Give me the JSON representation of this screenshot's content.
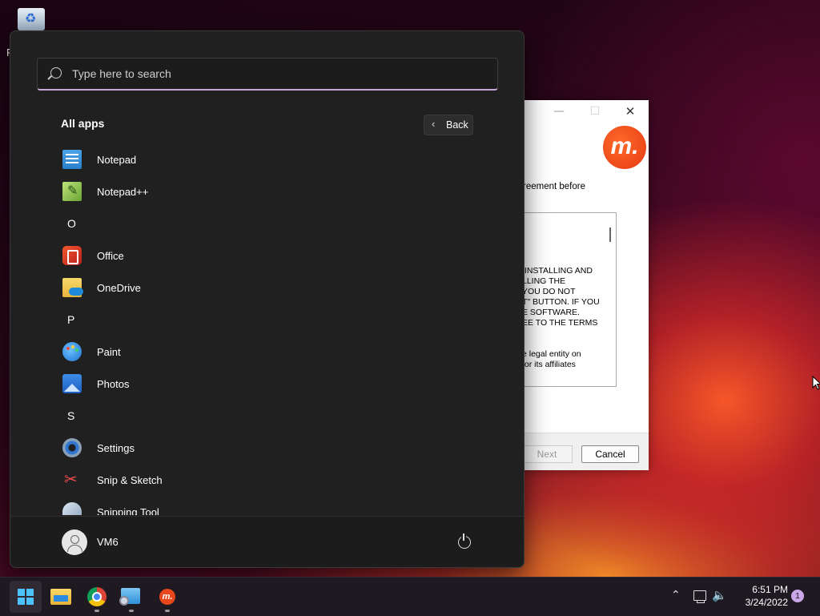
{
  "desktop": {
    "recycle_bin_label": "R"
  },
  "installer": {
    "minimize_glyph": "—",
    "maximize_glyph": "☐",
    "close_glyph": "✕",
    "logo_text": "m.",
    "header_text": "reement before",
    "license_text": " INSTALLING AND\nLLING THE\nYOU DO NOT\nT\" BUTTON. IF YOU\nE SOFTWARE.\nEE TO THE TERMS",
    "license_text_2": "e legal entity on\nfor its affiliates",
    "next_label": "Next",
    "cancel_label": "Cancel"
  },
  "start_menu": {
    "search_placeholder": "Type here to search",
    "all_apps_label": "All apps",
    "back_label": "Back",
    "apps": [
      {
        "type": "app",
        "name": "Notepad",
        "icon": "notepad-icon"
      },
      {
        "type": "app",
        "name": "Notepad++",
        "icon": "notepad-plus-plus-icon"
      },
      {
        "type": "letter",
        "name": "O"
      },
      {
        "type": "app",
        "name": "Office",
        "icon": "office-icon"
      },
      {
        "type": "app",
        "name": "OneDrive",
        "icon": "onedrive-icon"
      },
      {
        "type": "letter",
        "name": "P"
      },
      {
        "type": "app",
        "name": "Paint",
        "icon": "paint-icon"
      },
      {
        "type": "app",
        "name": "Photos",
        "icon": "photos-icon"
      },
      {
        "type": "letter",
        "name": "S"
      },
      {
        "type": "app",
        "name": "Settings",
        "icon": "settings-icon"
      },
      {
        "type": "app",
        "name": "Snip & Sketch",
        "icon": "snip-sketch-icon"
      },
      {
        "type": "app",
        "name": "Snipping Tool",
        "icon": "snipping-tool-icon"
      }
    ],
    "user_name": "VM6"
  },
  "taskbar": {
    "items": [
      "start",
      "file-explorer",
      "chrome",
      "setup",
      "installer-app"
    ],
    "time": "6:51 PM",
    "date": "3/24/2022",
    "notification_count": "1"
  },
  "colors": {
    "accent": "#4cc2ff",
    "search_underline": "#c7a6d6",
    "brand_orange": "#e8471c"
  }
}
